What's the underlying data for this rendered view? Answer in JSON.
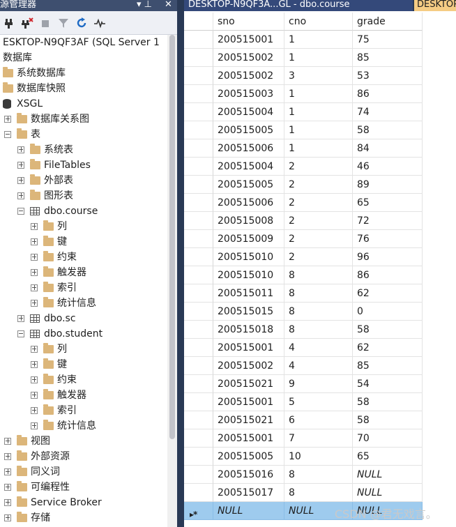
{
  "explorer": {
    "title": "對象资源管理器",
    "title_visible": "源管理器",
    "pin_glyph": "▾ ⊥",
    "close_glyph": "✕",
    "toolbar_icons": [
      "connect-icon",
      "disconnect-icon",
      "stop-icon",
      "filter-icon",
      "refresh-icon",
      "activity-monitor-icon"
    ],
    "nodes": [
      {
        "label": "ESKTOP-N9QF3AF (SQL Server 1",
        "level": 0,
        "expander": "none",
        "icon": "none"
      },
      {
        "label": "数据库",
        "level": 0,
        "expander": "none",
        "icon": "none"
      },
      {
        "label": "系统数据库",
        "level": 0,
        "expander": "none",
        "icon": "folder"
      },
      {
        "label": "数据库快照",
        "level": 0,
        "expander": "none",
        "icon": "folder"
      },
      {
        "label": "XSGL",
        "level": 0,
        "expander": "none",
        "icon": "db"
      },
      {
        "label": "数据库关系图",
        "level": 1,
        "expander": "plus",
        "icon": "folder"
      },
      {
        "label": "表",
        "level": 1,
        "expander": "minus",
        "icon": "folder"
      },
      {
        "label": "系统表",
        "level": 2,
        "expander": "plus",
        "icon": "folder"
      },
      {
        "label": "FileTables",
        "level": 2,
        "expander": "plus",
        "icon": "folder"
      },
      {
        "label": "外部表",
        "level": 2,
        "expander": "plus",
        "icon": "folder"
      },
      {
        "label": "图形表",
        "level": 2,
        "expander": "plus",
        "icon": "folder"
      },
      {
        "label": "dbo.course",
        "level": 2,
        "expander": "minus",
        "icon": "table"
      },
      {
        "label": "列",
        "level": 3,
        "expander": "plus",
        "icon": "folder"
      },
      {
        "label": "键",
        "level": 3,
        "expander": "plus",
        "icon": "folder"
      },
      {
        "label": "约束",
        "level": 3,
        "expander": "plus",
        "icon": "folder"
      },
      {
        "label": "触发器",
        "level": 3,
        "expander": "plus",
        "icon": "folder"
      },
      {
        "label": "索引",
        "level": 3,
        "expander": "plus",
        "icon": "folder"
      },
      {
        "label": "统计信息",
        "level": 3,
        "expander": "plus",
        "icon": "folder"
      },
      {
        "label": "dbo.sc",
        "level": 2,
        "expander": "plus",
        "icon": "table",
        "selected": true
      },
      {
        "label": "dbo.student",
        "level": 2,
        "expander": "minus",
        "icon": "table"
      },
      {
        "label": "列",
        "level": 3,
        "expander": "plus",
        "icon": "folder"
      },
      {
        "label": "键",
        "level": 3,
        "expander": "plus",
        "icon": "folder"
      },
      {
        "label": "约束",
        "level": 3,
        "expander": "plus",
        "icon": "folder"
      },
      {
        "label": "触发器",
        "level": 3,
        "expander": "plus",
        "icon": "folder"
      },
      {
        "label": "索引",
        "level": 3,
        "expander": "plus",
        "icon": "folder"
      },
      {
        "label": "统计信息",
        "level": 3,
        "expander": "plus",
        "icon": "folder"
      },
      {
        "label": "视图",
        "level": 1,
        "expander": "plus",
        "icon": "folder"
      },
      {
        "label": "外部资源",
        "level": 1,
        "expander": "plus",
        "icon": "folder"
      },
      {
        "label": "同义词",
        "level": 1,
        "expander": "plus",
        "icon": "folder"
      },
      {
        "label": "可编程性",
        "level": 1,
        "expander": "plus",
        "icon": "folder"
      },
      {
        "label": "Service Broker",
        "level": 1,
        "expander": "plus",
        "icon": "folder"
      },
      {
        "label": "存储",
        "level": 1,
        "expander": "plus",
        "icon": "folder"
      }
    ]
  },
  "tabs": {
    "active": "DESKTOP-N9QF3A...GL - dbo.course",
    "next": "DESKTOP"
  },
  "grid": {
    "columns": [
      "sno",
      "cno",
      "grade"
    ],
    "rows": [
      [
        "200515001",
        "1",
        "75"
      ],
      [
        "200515002",
        "1",
        "85"
      ],
      [
        "200515002",
        "3",
        "53"
      ],
      [
        "200515003",
        "1",
        "86"
      ],
      [
        "200515004",
        "1",
        "74"
      ],
      [
        "200515005",
        "1",
        "58"
      ],
      [
        "200515006",
        "1",
        "84"
      ],
      [
        "200515004",
        "2",
        "46"
      ],
      [
        "200515005",
        "2",
        "89"
      ],
      [
        "200515006",
        "2",
        "65"
      ],
      [
        "200515008",
        "2",
        "72"
      ],
      [
        "200515009",
        "2",
        "76"
      ],
      [
        "200515010",
        "2",
        "96"
      ],
      [
        "200515010",
        "8",
        "86"
      ],
      [
        "200515011",
        "8",
        "62"
      ],
      [
        "200515015",
        "8",
        "0"
      ],
      [
        "200515018",
        "8",
        "58"
      ],
      [
        "200515001",
        "4",
        "62"
      ],
      [
        "200515002",
        "4",
        "85"
      ],
      [
        "200515021",
        "9",
        "54"
      ],
      [
        "200515001",
        "5",
        "58"
      ],
      [
        "200515021",
        "6",
        "58"
      ],
      [
        "200515001",
        "7",
        "70"
      ],
      [
        "200515005",
        "10",
        "65"
      ],
      [
        "200515016",
        "8",
        "NULL"
      ],
      [
        "200515017",
        "8",
        "NULL"
      ]
    ],
    "new_row": [
      "NULL",
      "NULL",
      "NULL"
    ],
    "new_row_marker": "▸*"
  },
  "watermark": "CSDN @君无戏言。"
}
